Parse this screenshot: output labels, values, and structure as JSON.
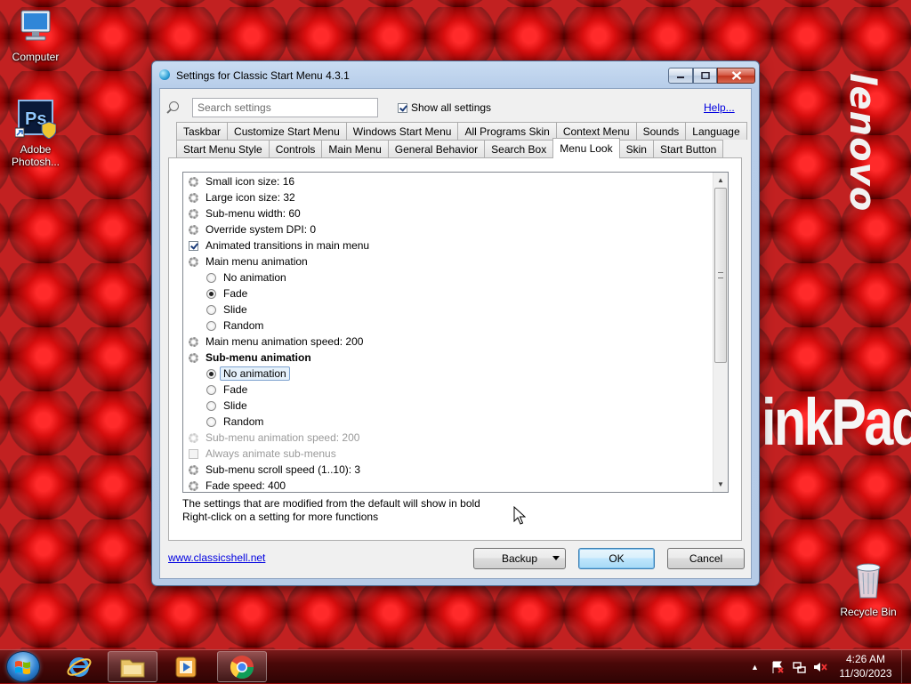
{
  "desktop": {
    "icons": [
      {
        "label": "Computer"
      },
      {
        "label": "Adobe Photosh..."
      },
      {
        "label": "Recycle Bin"
      }
    ],
    "brand_vertical": "lenovo",
    "brand_wordmark": "inkPad"
  },
  "window": {
    "title": "Settings for Classic Start Menu 4.3.1",
    "search": {
      "placeholder": "Search settings",
      "value": ""
    },
    "show_all_label": "Show all settings",
    "show_all_checked": true,
    "help_link": "Help...",
    "tabs_row1": [
      "Taskbar",
      "Customize Start Menu",
      "Windows Start Menu",
      "All Programs Skin",
      "Context Menu",
      "Sounds",
      "Language"
    ],
    "tabs_row2": [
      "Start Menu Style",
      "Controls",
      "Main Menu",
      "General Behavior",
      "Search Box",
      "Menu Look",
      "Skin",
      "Start Button"
    ],
    "active_tab": "Menu Look",
    "settings": [
      {
        "label": "Small icon size: 16",
        "kind": "setting",
        "level": 0
      },
      {
        "label": "Large icon size: 32",
        "kind": "setting",
        "level": 0
      },
      {
        "label": "Sub-menu width: 60",
        "kind": "setting",
        "level": 0
      },
      {
        "label": "Override system DPI: 0",
        "kind": "setting",
        "level": 0
      },
      {
        "label": "Animated transitions in main menu",
        "kind": "checkbox",
        "checked": true,
        "level": 0
      },
      {
        "label": "Main menu animation",
        "kind": "setting",
        "level": 0
      },
      {
        "label": "No animation",
        "kind": "radio",
        "selected": false,
        "level": 1
      },
      {
        "label": "Fade",
        "kind": "radio",
        "selected": true,
        "level": 1
      },
      {
        "label": "Slide",
        "kind": "radio",
        "selected": false,
        "level": 1
      },
      {
        "label": "Random",
        "kind": "radio",
        "selected": false,
        "level": 1
      },
      {
        "label": "Main menu animation speed: 200",
        "kind": "setting",
        "level": 0
      },
      {
        "label": "Sub-menu animation",
        "kind": "setting",
        "bold": true,
        "level": 0
      },
      {
        "label": "No animation",
        "kind": "radio",
        "selected": true,
        "focused": true,
        "level": 1
      },
      {
        "label": "Fade",
        "kind": "radio",
        "selected": false,
        "level": 1
      },
      {
        "label": "Slide",
        "kind": "radio",
        "selected": false,
        "level": 1
      },
      {
        "label": "Random",
        "kind": "radio",
        "selected": false,
        "level": 1
      },
      {
        "label": "Sub-menu animation speed: 200",
        "kind": "setting",
        "disabled": true,
        "level": 0
      },
      {
        "label": "Always animate sub-menus",
        "kind": "checkbox",
        "checked": false,
        "disabled": true,
        "level": 0
      },
      {
        "label": "Sub-menu scroll speed (1..10): 3",
        "kind": "setting",
        "level": 0
      },
      {
        "label": "Fade speed: 400",
        "kind": "setting",
        "level": 0
      }
    ],
    "note_line1": "The settings that are modified from the default will show in bold",
    "note_line2": "Right-click on a setting for more functions",
    "site_link": "www.classicshell.net",
    "buttons": {
      "backup": "Backup",
      "ok": "OK",
      "cancel": "Cancel"
    }
  },
  "taskbar": {
    "pinned": [
      "internet-explorer",
      "windows-explorer",
      "media-player",
      "chrome"
    ],
    "clock_time": "4:26 AM",
    "clock_date": "11/30/2023"
  },
  "colors": {
    "accent_link": "#0000e0",
    "desktop_red": "#a10808",
    "window_frame": "#b7cde9"
  }
}
